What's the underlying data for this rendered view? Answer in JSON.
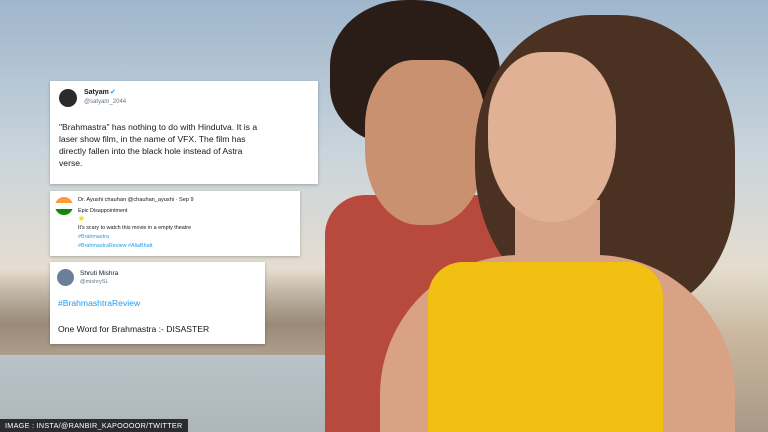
{
  "tweets": [
    {
      "name": "Satyam",
      "handle": "@satyam_2044",
      "verified_badge": "✔",
      "lines": [
        "\"Brahmastra\" has nothing to do with Hindutva. It is a",
        "laser show film, in the name of VFX. The film has",
        "directly fallen into the black hole instead of Astra",
        "verse."
      ]
    },
    {
      "header": "Dr. Ayushi chauhan @chauhan_ayushi · Sep 9",
      "lines": [
        "Epic Disappointment",
        "⭐",
        "It's scary to watch this movie in a empty theatre",
        "#Brahmastra",
        "#BrahmastraReview #AliaBhatt"
      ]
    },
    {
      "name": "Shruti Mishra",
      "handle": "@mishrySL",
      "lines": [
        "#BrahmashtraReview",
        "One Word for Brahmastra :- DISASTER"
      ]
    }
  ],
  "credit": "IMAGE : INSTA/@RANBIR_KAPOOOOR/TWITTER",
  "colors": {
    "hashtag": "#1d9bf0",
    "top": "#f2c012",
    "shirt": "#b74a3c"
  }
}
